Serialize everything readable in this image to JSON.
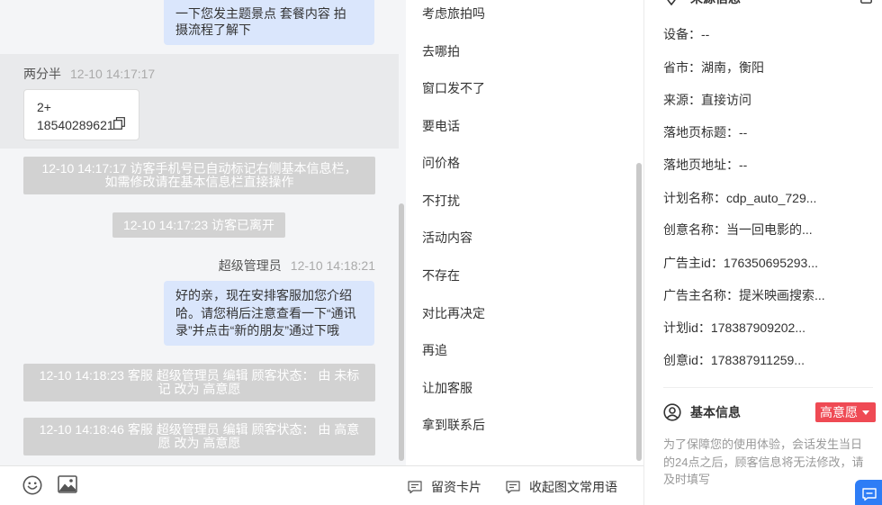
{
  "colors": {
    "chat_background": "#f4f5f7",
    "bubble": "#dae6fc",
    "system_message": "#d2d2d2",
    "highlight_row": "#e9eaec",
    "intent_badge": "#ef4a54",
    "accent": "#2e7df6"
  },
  "chat": {
    "top_bubble": {
      "lines": [
        "一下您发主题景点 套餐内容 拍",
        "摄流程了解下"
      ]
    },
    "visitor_message": {
      "sender": "两分半",
      "time": "12-10 14:17:17",
      "card_lines": [
        "2+",
        "18540289621"
      ],
      "copy_icon": "copy-icon"
    },
    "system_1": {
      "lines": [
        "12-10 14:17:17 访客手机号已自动标记右侧基本信息栏，",
        "如需修改请在基本信息栏直接操作"
      ]
    },
    "system_2": {
      "lines": [
        "12-10 14:17:23 访客已离开"
      ]
    },
    "agent_message": {
      "sender": "超级管理员",
      "time": "12-10 14:18:21",
      "lines": [
        "好的亲，现在安排客服加您介绍",
        "哈。请您稍后注意查看一下“通讯",
        "录”并点击“新的朋友”通过下哦"
      ]
    },
    "system_3": {
      "lines": [
        "12-10 14:18:23 客服 超级管理员 编辑 顾客状态： 由 未标",
        "记 改为 高意愿"
      ]
    },
    "system_4": {
      "lines": [
        "12-10 14:18:46 客服 超级管理员 编辑 顾客状态： 由 高意",
        "愿 改为 高意愿"
      ]
    }
  },
  "input_toolbar": {
    "icons": [
      "emoji-icon",
      "image-icon"
    ]
  },
  "quick_phrases": {
    "items": [
      "考虑旅拍吗",
      "去哪拍",
      "窗口发不了",
      "要电话",
      "问价格",
      "不打扰",
      "活动内容",
      "不存在",
      "对比再决定",
      "再追",
      "让加客服",
      "拿到联系后"
    ],
    "lead_card_label": "留资卡片",
    "lead_card_icon": "message-card-icon",
    "collapse_label": "收起图文常用语",
    "collapse_icon": "message-lines-icon"
  },
  "source_info": {
    "title": "来源信息",
    "title_icon": "location-pin-icon",
    "edit_icon": "edit-square-icon",
    "rows": [
      {
        "label": "设备：",
        "value": "--"
      },
      {
        "label": "省市：",
        "value": "湖南，衡阳"
      },
      {
        "label": "来源：",
        "value": "直接访问"
      },
      {
        "label": "落地页标题：",
        "value": "--"
      },
      {
        "label": "落地页地址：",
        "value": "--"
      },
      {
        "label": "计划名称：",
        "value": "cdp_auto_729..."
      },
      {
        "label": "创意名称：",
        "value": "当一回电影的..."
      },
      {
        "label": "广告主id：",
        "value": "176350695293..."
      },
      {
        "label": "广告主名称：",
        "value": "提米映画搜索..."
      },
      {
        "label": "计划id：",
        "value": "178387909202..."
      },
      {
        "label": "创意id：",
        "value": "178387911259..."
      }
    ]
  },
  "basic_info": {
    "title": "基本信息",
    "title_icon": "user-circle-icon",
    "intent_badge": "高意愿",
    "notice_lines": [
      "为了保障您的使用体验，会话发生当日",
      "的24点之后，顾客信息将无法修改，请",
      "及时填写"
    ]
  },
  "floating_button": {
    "icon": "chat-icon"
  }
}
